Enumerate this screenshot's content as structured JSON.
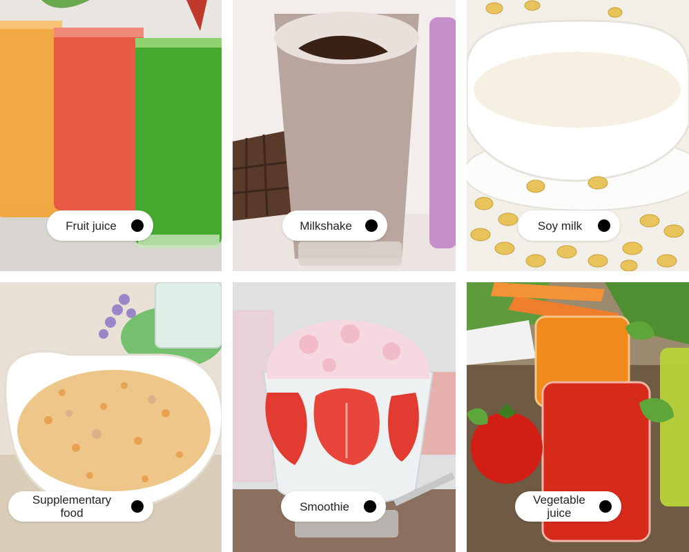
{
  "tiles": [
    {
      "label": "Fruit juice"
    },
    {
      "label": "Milkshake"
    },
    {
      "label": "Soy milk"
    },
    {
      "label": "Supplementary\nfood"
    },
    {
      "label": "Smoothie"
    },
    {
      "label": "Vegetable\njuice"
    }
  ],
  "colors": {
    "pill_bg": "#ffffff",
    "dot": "#000000",
    "gap": "#ffffff"
  }
}
